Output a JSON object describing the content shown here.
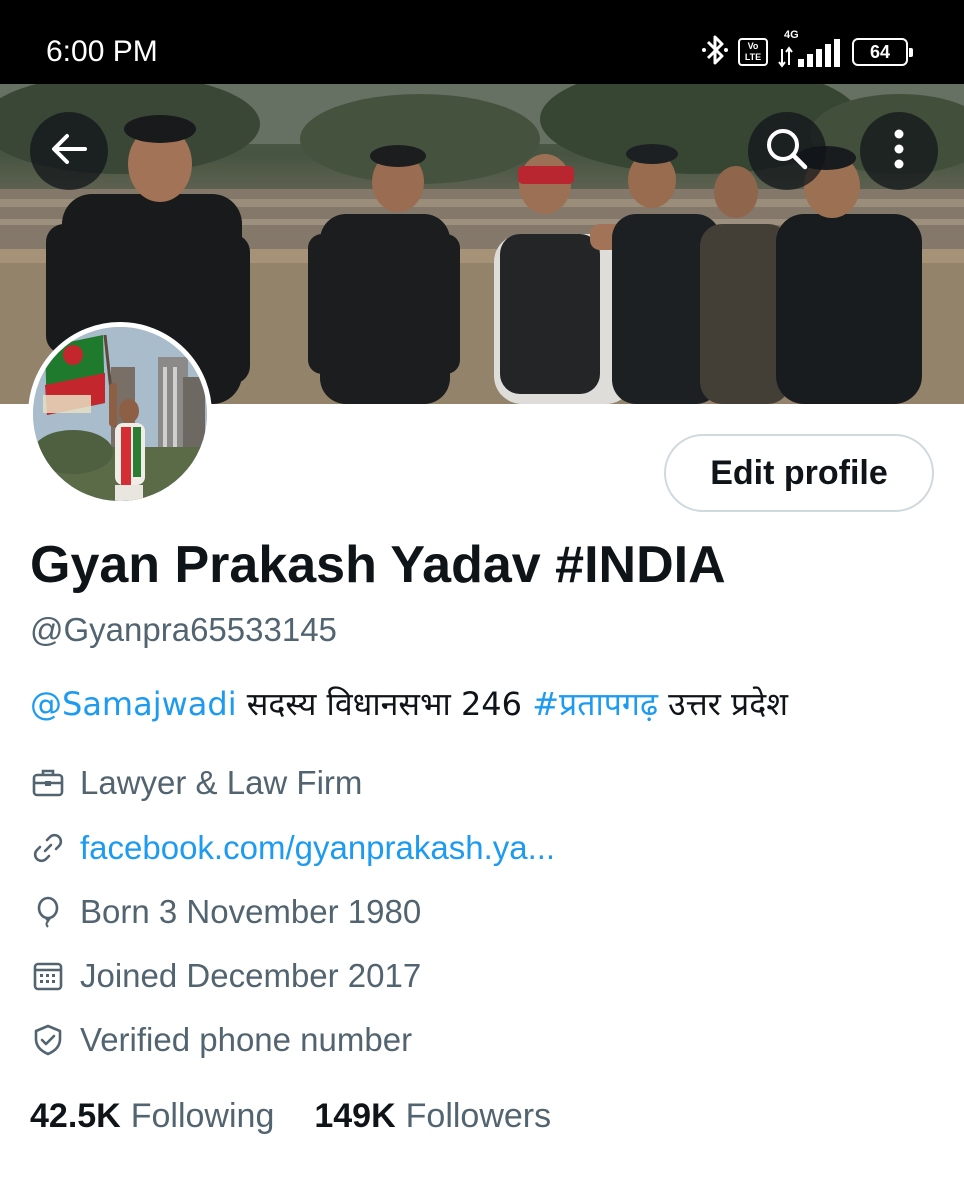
{
  "status_bar": {
    "time": "6:00 PM",
    "volte": "Vo LTE",
    "network": "4G",
    "battery": "64"
  },
  "profile": {
    "display_name": "Gyan Prakash Yadav #INDIA",
    "handle": "@Gyanpra65533145",
    "edit_button": "Edit profile",
    "bio": {
      "mention": "@Samajwadi",
      "text1": " सदस्य  विधानसभा 246 ",
      "hashtag": "#प्रतापगढ़",
      "text2": " उत्तर प्रदेश"
    },
    "meta": {
      "profession": "Lawyer & Law Firm",
      "website": "facebook.com/gyanprakash.ya...",
      "birthday": "Born 3 November 1980",
      "joined": "Joined December 2017",
      "verified": "Verified phone number"
    },
    "stats": {
      "following_count": "42.5K",
      "following_label": "Following",
      "followers_count": "149K",
      "followers_label": "Followers"
    }
  },
  "icons": {
    "back": "arrow-left-icon",
    "search": "search-icon",
    "more": "more-vertical-icon",
    "profession": "briefcase-icon",
    "website": "link-icon",
    "birthday": "balloon-icon",
    "joined": "calendar-icon",
    "verified": "shield-check-icon"
  },
  "colors": {
    "link": "#1d9bf0",
    "secondary_text": "#536471",
    "primary_text": "#0f1419",
    "button_border": "#cfd9de"
  }
}
